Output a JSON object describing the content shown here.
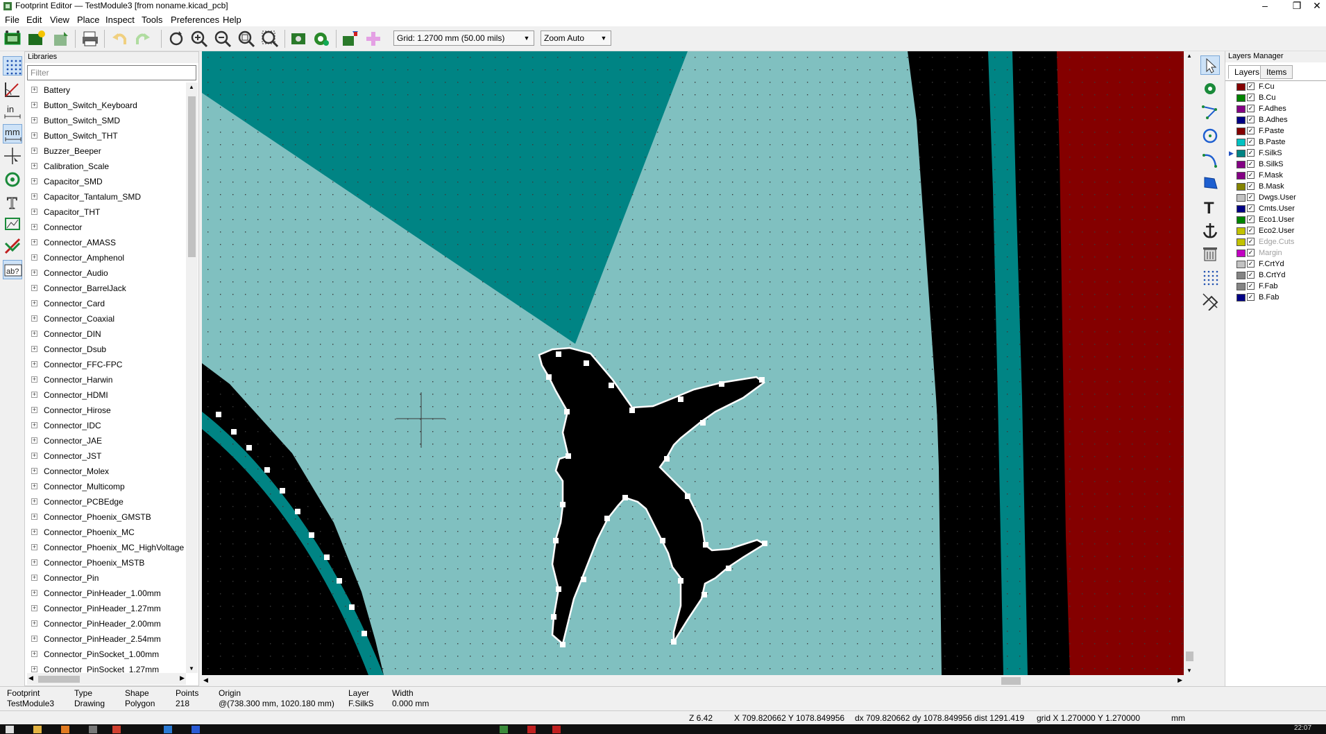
{
  "window": {
    "title": "Footprint Editor — TestModule3 [from noname.kicad_pcb]"
  },
  "menu": [
    "File",
    "Edit",
    "View",
    "Place",
    "Inspect",
    "Tools",
    "Preferences",
    "Help"
  ],
  "toolbar": {
    "grid": "Grid: 1.2700 mm (50.00 mils)",
    "zoom": "Zoom Auto"
  },
  "libraries": {
    "header": "Libraries",
    "filter_placeholder": "Filter",
    "items": [
      "Battery",
      "Button_Switch_Keyboard",
      "Button_Switch_SMD",
      "Button_Switch_THT",
      "Buzzer_Beeper",
      "Calibration_Scale",
      "Capacitor_SMD",
      "Capacitor_Tantalum_SMD",
      "Capacitor_THT",
      "Connector",
      "Connector_AMASS",
      "Connector_Amphenol",
      "Connector_Audio",
      "Connector_BarrelJack",
      "Connector_Card",
      "Connector_Coaxial",
      "Connector_DIN",
      "Connector_Dsub",
      "Connector_FFC-FPC",
      "Connector_Harwin",
      "Connector_HDMI",
      "Connector_Hirose",
      "Connector_IDC",
      "Connector_JAE",
      "Connector_JST",
      "Connector_Molex",
      "Connector_Multicomp",
      "Connector_PCBEdge",
      "Connector_Phoenix_GMSTB",
      "Connector_Phoenix_MC",
      "Connector_Phoenix_MC_HighVoltage",
      "Connector_Phoenix_MSTB",
      "Connector_Pin",
      "Connector_PinHeader_1.00mm",
      "Connector_PinHeader_1.27mm",
      "Connector_PinHeader_2.00mm",
      "Connector_PinHeader_2.54mm",
      "Connector_PinSocket_1.00mm",
      "Connector_PinSocket_1.27mm"
    ]
  },
  "layers_manager": {
    "header": "Layers Manager",
    "tabs": [
      "Layers",
      "Items"
    ],
    "layers": [
      {
        "name": "F.Cu",
        "color": "#840000",
        "checked": true,
        "active": false,
        "dim": false
      },
      {
        "name": "B.Cu",
        "color": "#008400",
        "checked": true,
        "active": false,
        "dim": false
      },
      {
        "name": "F.Adhes",
        "color": "#840084",
        "checked": true,
        "active": false,
        "dim": false
      },
      {
        "name": "B.Adhes",
        "color": "#000084",
        "checked": true,
        "active": false,
        "dim": false
      },
      {
        "name": "F.Paste",
        "color": "#840000",
        "checked": true,
        "active": false,
        "dim": false
      },
      {
        "name": "B.Paste",
        "color": "#00c2c2",
        "checked": true,
        "active": false,
        "dim": false
      },
      {
        "name": "F.SilkS",
        "color": "#008484",
        "checked": true,
        "active": true,
        "dim": false
      },
      {
        "name": "B.SilkS",
        "color": "#840084",
        "checked": true,
        "active": false,
        "dim": false
      },
      {
        "name": "F.Mask",
        "color": "#840084",
        "checked": true,
        "active": false,
        "dim": false
      },
      {
        "name": "B.Mask",
        "color": "#848400",
        "checked": true,
        "active": false,
        "dim": false
      },
      {
        "name": "Dwgs.User",
        "color": "#c2c2c2",
        "checked": true,
        "active": false,
        "dim": false
      },
      {
        "name": "Cmts.User",
        "color": "#000084",
        "checked": true,
        "active": false,
        "dim": false
      },
      {
        "name": "Eco1.User",
        "color": "#008400",
        "checked": true,
        "active": false,
        "dim": false
      },
      {
        "name": "Eco2.User",
        "color": "#c2c200",
        "checked": true,
        "active": false,
        "dim": false
      },
      {
        "name": "Edge.Cuts",
        "color": "#c2c200",
        "checked": true,
        "active": false,
        "dim": true
      },
      {
        "name": "Margin",
        "color": "#c200c2",
        "checked": true,
        "active": false,
        "dim": true
      },
      {
        "name": "F.CrtYd",
        "color": "#c2c2c2",
        "checked": true,
        "active": false,
        "dim": false
      },
      {
        "name": "B.CrtYd",
        "color": "#848484",
        "checked": true,
        "active": false,
        "dim": false
      },
      {
        "name": "F.Fab",
        "color": "#848484",
        "checked": true,
        "active": false,
        "dim": false
      },
      {
        "name": "B.Fab",
        "color": "#000084",
        "checked": true,
        "active": false,
        "dim": false
      }
    ]
  },
  "message_panel": [
    {
      "label": "Footprint",
      "value": "TestModule3"
    },
    {
      "label": "Type",
      "value": "Drawing"
    },
    {
      "label": "Shape",
      "value": "Polygon"
    },
    {
      "label": "Points",
      "value": "218"
    },
    {
      "label": "Origin",
      "value": "@(738.300 mm, 1020.180 mm)"
    },
    {
      "label": "Layer",
      "value": "F.SilkS"
    },
    {
      "label": "Width",
      "value": "0.000 mm"
    }
  ],
  "status": {
    "zoom": "Z 6.42",
    "cursor": "X 709.820662  Y 1078.849956",
    "delta": "dx 709.820662  dy 1078.849956  dist 1291.419",
    "grid": "grid X 1.270000  Y 1.270000",
    "units": "mm"
  },
  "taskbar": {
    "clock": "22:07"
  },
  "colors": {
    "silkscreen": "#008484",
    "silkscreen_light": "#80c0c0",
    "copper": "#840000",
    "background": "#000000"
  }
}
